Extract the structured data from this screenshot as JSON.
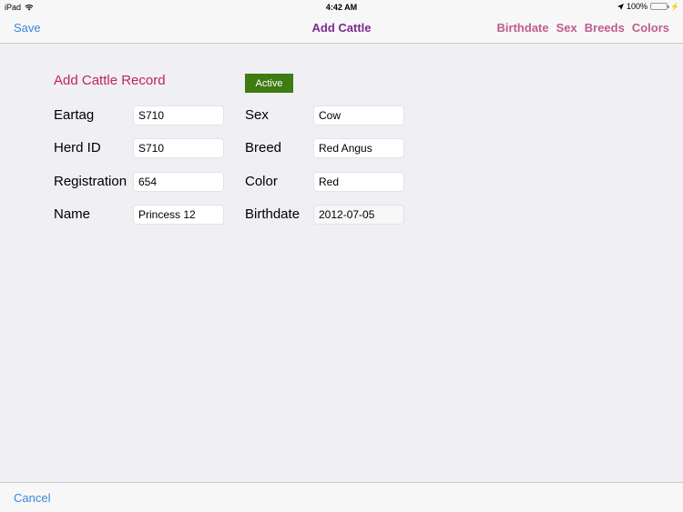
{
  "status_bar": {
    "device": "iPad",
    "time": "4:42 AM",
    "battery": "100%",
    "icons": [
      "wifi-icon",
      "location-arrow-icon",
      "battery-icon",
      "charging-bolt-icon"
    ]
  },
  "nav": {
    "save_label": "Save",
    "title": "Add Cattle",
    "right_items": [
      "Birthdate",
      "Sex",
      "Breeds",
      "Colors"
    ]
  },
  "form": {
    "title": "Add Cattle Record",
    "active_label": "Active",
    "left_fields": [
      {
        "label": "Eartag",
        "value": "S710"
      },
      {
        "label": "Herd ID",
        "value": "S710"
      },
      {
        "label": "Registration",
        "value": "654"
      },
      {
        "label": "Name",
        "value": "Princess 12"
      }
    ],
    "right_fields": [
      {
        "label": "Sex",
        "value": "Cow"
      },
      {
        "label": "Breed",
        "value": "Red Angus"
      },
      {
        "label": "Color",
        "value": "Red"
      },
      {
        "label": "Birthdate",
        "value": "2012-07-05"
      }
    ]
  },
  "toolbar": {
    "cancel_label": "Cancel"
  },
  "colors": {
    "link_blue": "#3a87d9",
    "title_purple": "#7b2a8c",
    "nav_pink": "#c05d8e",
    "form_title_red": "#c0245a",
    "active_green": "#3e7b10"
  }
}
